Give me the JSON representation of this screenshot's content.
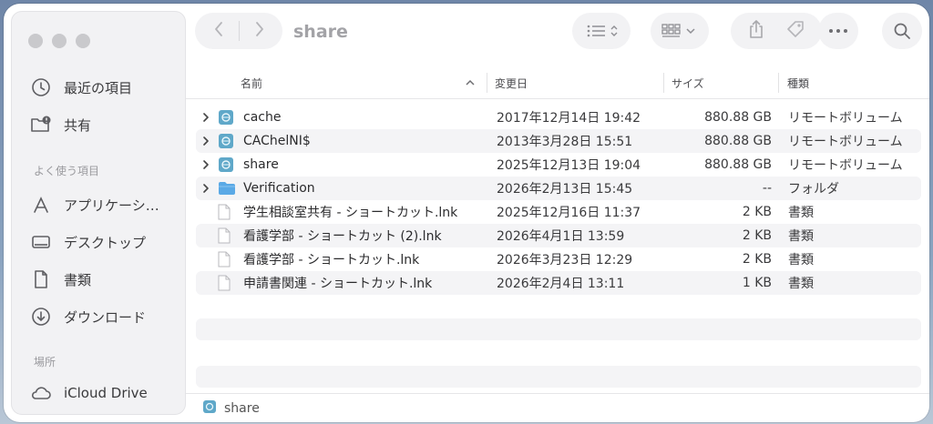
{
  "window": {
    "title": "share"
  },
  "sidebar": {
    "items_top": [
      {
        "label": "最近の項目",
        "icon": "clock-icon"
      },
      {
        "label": "共有",
        "icon": "shared-folder-icon"
      }
    ],
    "favorites_label": "よく使う項目",
    "favorites": [
      {
        "label": "アプリケーション",
        "icon": "applications-icon"
      },
      {
        "label": "デスクトップ",
        "icon": "desktop-icon"
      },
      {
        "label": "書類",
        "icon": "document-icon"
      },
      {
        "label": "ダウンロード",
        "icon": "download-icon"
      }
    ],
    "locations_label": "場所",
    "locations": [
      {
        "label": "iCloud Drive",
        "icon": "cloud-icon"
      }
    ]
  },
  "columns": {
    "name": "名前",
    "modified": "変更日",
    "size": "サイズ",
    "kind": "種類"
  },
  "files": [
    {
      "name": "cache",
      "modified": "2017年12月14日 19:42",
      "size": "880.88 GB",
      "kind": "リモートボリューム",
      "type": "volume",
      "expandable": true
    },
    {
      "name": "CAChelNI$",
      "modified": "2013年3月28日 15:51",
      "size": "880.88 GB",
      "kind": "リモートボリューム",
      "type": "volume",
      "expandable": true
    },
    {
      "name": "share",
      "modified": "2025年12月13日 19:04",
      "size": "880.88 GB",
      "kind": "リモートボリューム",
      "type": "volume",
      "expandable": true
    },
    {
      "name": "Verification",
      "modified": "2026年2月13日 15:45",
      "size": "--",
      "kind": "フォルダ",
      "type": "folder",
      "expandable": true
    },
    {
      "name": "学生相談室共有 - ショートカット.lnk",
      "modified": "2025年12月16日 11:37",
      "size": "2 KB",
      "kind": "書類",
      "type": "file",
      "expandable": false
    },
    {
      "name": "看護学部 - ショートカット (2).lnk",
      "modified": "2026年4月1日 13:59",
      "size": "2 KB",
      "kind": "書類",
      "type": "file",
      "expandable": false
    },
    {
      "name": "看護学部 - ショートカット.lnk",
      "modified": "2026年3月23日 12:29",
      "size": "2 KB",
      "kind": "書類",
      "type": "file",
      "expandable": false
    },
    {
      "name": "申請書関連 - ショートカット.lnk",
      "modified": "2026年2月4日 13:11",
      "size": "1 KB",
      "kind": "書類",
      "type": "file",
      "expandable": false
    }
  ],
  "pathbar": {
    "label": "share",
    "icon": "network-volume-icon"
  },
  "colors": {
    "volume": "#5fa8c9",
    "folder": "#5aa9e6",
    "accent": "#8e8e93"
  }
}
